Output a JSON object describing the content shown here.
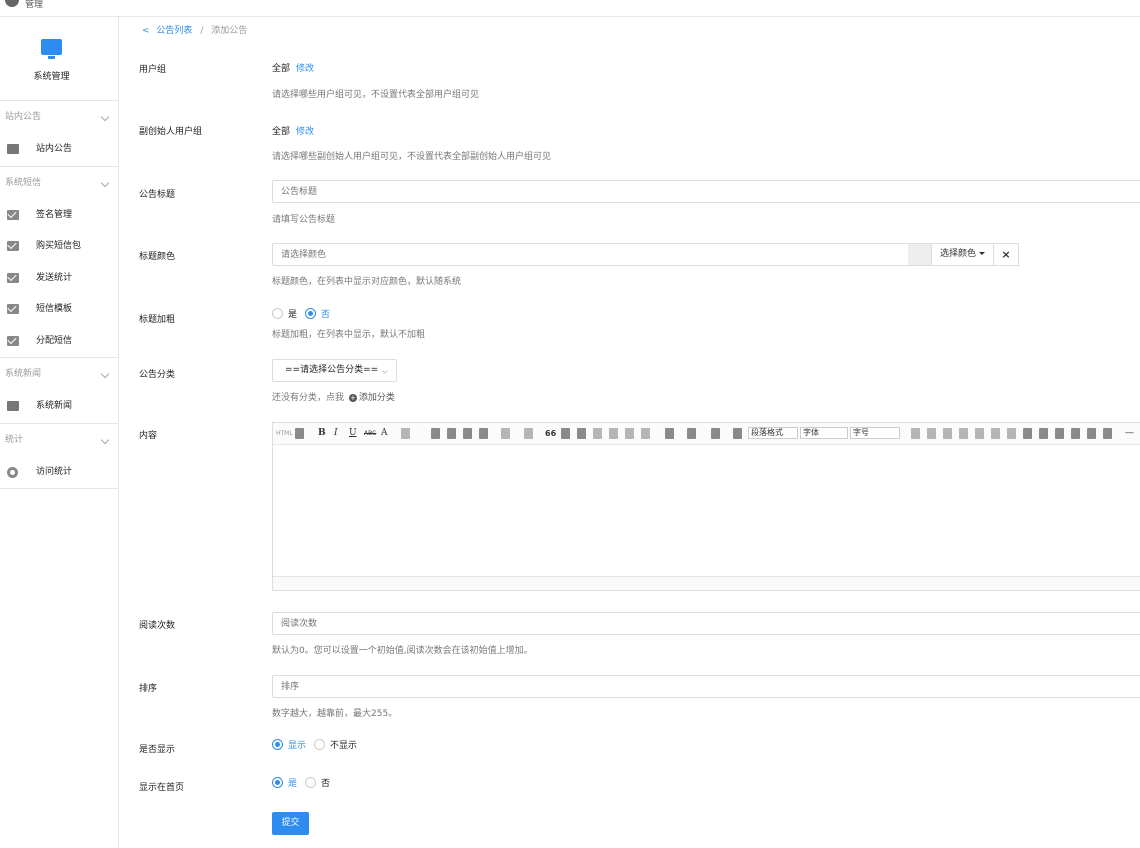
{
  "topbar": {
    "username": "管理"
  },
  "sidebar": {
    "brand": "系统管理",
    "groups": [
      {
        "title": "站内公告",
        "items": [
          {
            "label": "站内公告",
            "icon": "doc-icon"
          }
        ]
      },
      {
        "title": "系统短信",
        "items": [
          {
            "label": "签名管理",
            "icon": "mail-icon"
          },
          {
            "label": "购买短信包",
            "icon": "mail-icon"
          },
          {
            "label": "发送统计",
            "icon": "mail-icon"
          },
          {
            "label": "短信模板",
            "icon": "mail-icon"
          },
          {
            "label": "分配短信",
            "icon": "mail-icon"
          }
        ]
      },
      {
        "title": "系统新闻",
        "items": [
          {
            "label": "系统新闻",
            "icon": "doc-icon"
          }
        ]
      },
      {
        "title": "统计",
        "items": [
          {
            "label": "访问统计",
            "icon": "chart-icon"
          }
        ]
      }
    ]
  },
  "breadcrumb": {
    "back": "<",
    "parent": "公告列表",
    "sep": "/",
    "current": "添加公告"
  },
  "form": {
    "usergroup": {
      "label": "用户组",
      "value": "全部",
      "edit": "修改",
      "help": "请选择哪些用户组可见，不设置代表全部用户组可见"
    },
    "founder_group": {
      "label": "副创始人用户组",
      "value": "全部",
      "edit": "修改",
      "help": "请选择哪些副创始人用户组可见，不设置代表全部副创始人用户组可见"
    },
    "title": {
      "label": "公告标题",
      "placeholder": "公告标题",
      "help": "请填写公告标题"
    },
    "title_color": {
      "label": "标题颜色",
      "placeholder": "请选择颜色",
      "button": "选择颜色",
      "clear": "×",
      "help": "标题颜色，在列表中显示对应颜色，默认随系统"
    },
    "title_bold": {
      "label": "标题加粗",
      "opt_yes": "是",
      "opt_no": "否",
      "selected": "否",
      "help": "标题加粗，在列表中显示，默认不加粗"
    },
    "category": {
      "label": "公告分类",
      "select_value": "==请选择公告分类==",
      "help_prefix": "还没有分类，点我",
      "help_link": "添加分类"
    },
    "content": {
      "label": "内容",
      "toolbar_text": {
        "bold": "B",
        "italic": "I",
        "underline": "U",
        "strike": "ABC",
        "font_a": "A",
        "quote": "66",
        "para": "段落格式",
        "font": "字体",
        "size": "字号",
        "dash": "—",
        "html": "HTML"
      }
    },
    "read_count": {
      "label": "阅读次数",
      "placeholder": "阅读次数",
      "help": "默认为0。您可以设置一个初始值,阅读次数会在该初始值上增加。"
    },
    "sort": {
      "label": "排序",
      "placeholder": "排序",
      "help": "数字越大，越靠前，最大255。"
    },
    "visible": {
      "label": "是否显示",
      "opt_show": "显示",
      "opt_hide": "不显示",
      "selected": "显示"
    },
    "homepage": {
      "label": "显示在首页",
      "opt_yes": "是",
      "opt_no": "否",
      "selected": "是"
    },
    "submit": "提交"
  },
  "colors": {
    "accent": "#2d8cf0",
    "border": "#dddddd",
    "muted": "#777777"
  }
}
